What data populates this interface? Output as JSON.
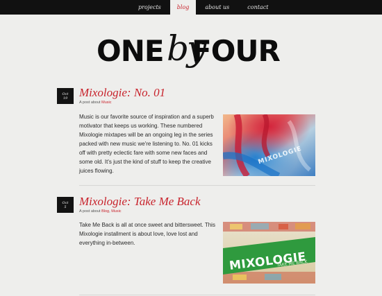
{
  "nav": {
    "items": [
      {
        "label": "projects"
      },
      {
        "label": "blog"
      },
      {
        "label": "about us"
      },
      {
        "label": "contact"
      }
    ]
  },
  "logo": {
    "one": "ONE",
    "by": "by",
    "four": "FOUR"
  },
  "colors": {
    "accent": "#c8232c",
    "dark": "#111111",
    "background": "#eeeeec"
  },
  "posts": [
    {
      "month": "Oct",
      "day": "19",
      "title": "Mixologie: No. 01",
      "meta_prefix": "A post about ",
      "categories": [
        "Music"
      ],
      "body": "Music is our favorite source of inspiration and a superb motivator that keeps us working. These numbered Mixologie mixtapes will be an ongoing leg in the series packed with new music we're listening to. No. 01 kicks off with pretty eclectic fare with some new faces and some old. It's just the kind of stuff to keep the creative juices flowing.",
      "image_text": "MIXOLOGIE"
    },
    {
      "month": "Oct",
      "day": "5",
      "title": "Mixologie: Take Me Back",
      "meta_prefix": "A post about ",
      "categories": [
        "Blog",
        "Music"
      ],
      "category_separator": ", ",
      "body": "Take Me Back is all at once sweet and bittersweet. This Mixologie installment is about love, love lost and everything in-between.",
      "image_text": "MIXOLOGIE",
      "image_subtext": "TAKE ME BACK"
    }
  ]
}
